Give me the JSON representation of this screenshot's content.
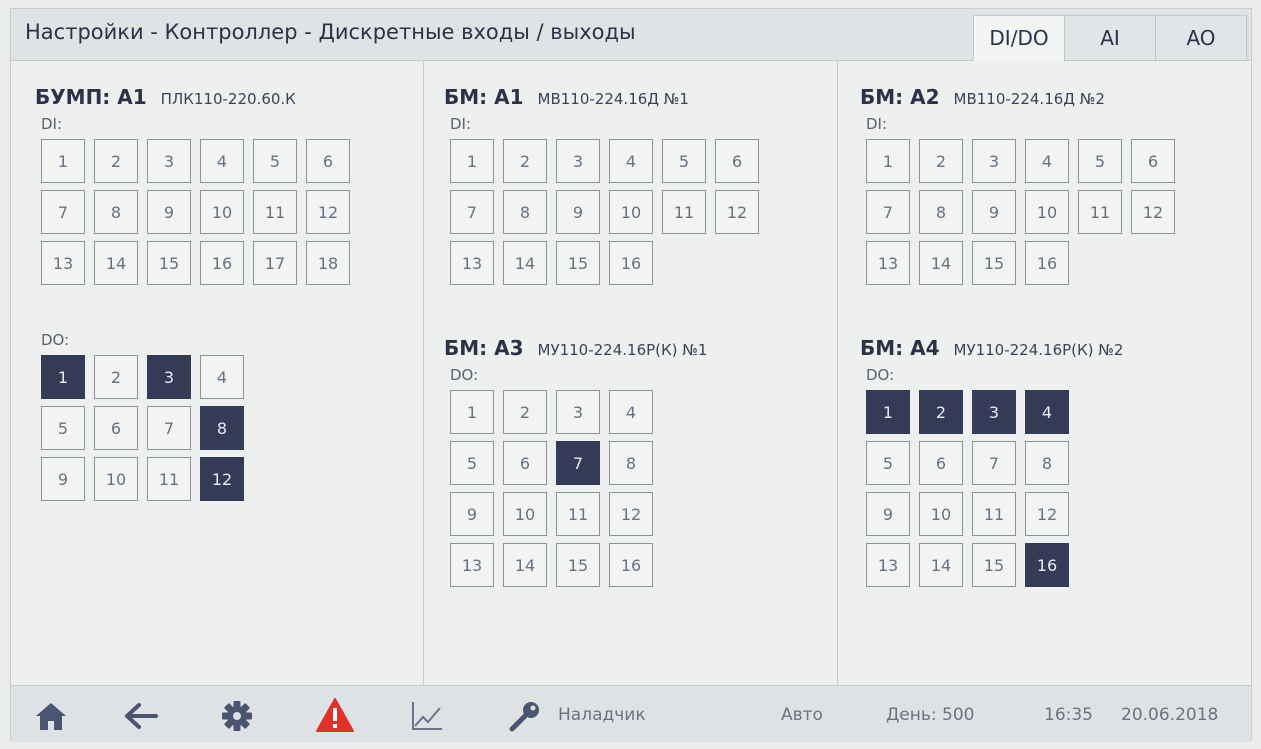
{
  "header": {
    "title": "Настройки - Контроллер - Дискретные входы / выходы",
    "tabs": [
      {
        "label": "DI/DO",
        "active": true
      },
      {
        "label": "AI",
        "active": false
      },
      {
        "label": "AO",
        "active": false
      }
    ]
  },
  "blocks": [
    {
      "id": "bump-a1",
      "name": "БУМП: A1",
      "model": "ПЛК110-220.60.К",
      "section": "DI:",
      "columns": 6,
      "cells": [
        {
          "n": "1",
          "on": false
        },
        {
          "n": "2",
          "on": false
        },
        {
          "n": "3",
          "on": false
        },
        {
          "n": "4",
          "on": false
        },
        {
          "n": "5",
          "on": false
        },
        {
          "n": "6",
          "on": false
        },
        {
          "n": "7",
          "on": false
        },
        {
          "n": "8",
          "on": false
        },
        {
          "n": "9",
          "on": false
        },
        {
          "n": "10",
          "on": false
        },
        {
          "n": "11",
          "on": false
        },
        {
          "n": "12",
          "on": false
        },
        {
          "n": "13",
          "on": false
        },
        {
          "n": "14",
          "on": false
        },
        {
          "n": "15",
          "on": false
        },
        {
          "n": "16",
          "on": false
        },
        {
          "n": "17",
          "on": false
        },
        {
          "n": "18",
          "on": false
        }
      ]
    },
    {
      "id": "bump-a1-do",
      "name": "",
      "model": "",
      "section": "DO:",
      "columns": 4,
      "cells": [
        {
          "n": "1",
          "on": true
        },
        {
          "n": "2",
          "on": false
        },
        {
          "n": "3",
          "on": true
        },
        {
          "n": "4",
          "on": false
        },
        {
          "n": "5",
          "on": false
        },
        {
          "n": "6",
          "on": false
        },
        {
          "n": "7",
          "on": false
        },
        {
          "n": "8",
          "on": true
        },
        {
          "n": "9",
          "on": false
        },
        {
          "n": "10",
          "on": false
        },
        {
          "n": "11",
          "on": false
        },
        {
          "n": "12",
          "on": true
        }
      ]
    },
    {
      "id": "bm-a1",
      "name": "БМ: A1",
      "model": "МВ110-224.16Д №1",
      "section": "DI:",
      "columns": 6,
      "cells": [
        {
          "n": "1",
          "on": false
        },
        {
          "n": "2",
          "on": false
        },
        {
          "n": "3",
          "on": false
        },
        {
          "n": "4",
          "on": false
        },
        {
          "n": "5",
          "on": false
        },
        {
          "n": "6",
          "on": false
        },
        {
          "n": "7",
          "on": false
        },
        {
          "n": "8",
          "on": false
        },
        {
          "n": "9",
          "on": false
        },
        {
          "n": "10",
          "on": false
        },
        {
          "n": "11",
          "on": false
        },
        {
          "n": "12",
          "on": false
        },
        {
          "n": "13",
          "on": false
        },
        {
          "n": "14",
          "on": false
        },
        {
          "n": "15",
          "on": false
        },
        {
          "n": "16",
          "on": false
        }
      ]
    },
    {
      "id": "bm-a3",
      "name": "БМ: A3",
      "model": "МУ110-224.16Р(К) №1",
      "section": "DO:",
      "columns": 4,
      "cells": [
        {
          "n": "1",
          "on": false
        },
        {
          "n": "2",
          "on": false
        },
        {
          "n": "3",
          "on": false
        },
        {
          "n": "4",
          "on": false
        },
        {
          "n": "5",
          "on": false
        },
        {
          "n": "6",
          "on": false
        },
        {
          "n": "7",
          "on": true
        },
        {
          "n": "8",
          "on": false
        },
        {
          "n": "9",
          "on": false
        },
        {
          "n": "10",
          "on": false
        },
        {
          "n": "11",
          "on": false
        },
        {
          "n": "12",
          "on": false
        },
        {
          "n": "13",
          "on": false
        },
        {
          "n": "14",
          "on": false
        },
        {
          "n": "15",
          "on": false
        },
        {
          "n": "16",
          "on": false
        }
      ]
    },
    {
      "id": "bm-a2",
      "name": "БМ: A2",
      "model": "МВ110-224.16Д №2",
      "section": "DI:",
      "columns": 6,
      "cells": [
        {
          "n": "1",
          "on": false
        },
        {
          "n": "2",
          "on": false
        },
        {
          "n": "3",
          "on": false
        },
        {
          "n": "4",
          "on": false
        },
        {
          "n": "5",
          "on": false
        },
        {
          "n": "6",
          "on": false
        },
        {
          "n": "7",
          "on": false
        },
        {
          "n": "8",
          "on": false
        },
        {
          "n": "9",
          "on": false
        },
        {
          "n": "10",
          "on": false
        },
        {
          "n": "11",
          "on": false
        },
        {
          "n": "12",
          "on": false
        },
        {
          "n": "13",
          "on": false
        },
        {
          "n": "14",
          "on": false
        },
        {
          "n": "15",
          "on": false
        },
        {
          "n": "16",
          "on": false
        }
      ]
    },
    {
      "id": "bm-a4",
      "name": "БМ: A4",
      "model": "МУ110-224.16Р(К) №2",
      "section": "DO:",
      "columns": 4,
      "cells": [
        {
          "n": "1",
          "on": true
        },
        {
          "n": "2",
          "on": true
        },
        {
          "n": "3",
          "on": true
        },
        {
          "n": "4",
          "on": true
        },
        {
          "n": "5",
          "on": false
        },
        {
          "n": "6",
          "on": false
        },
        {
          "n": "7",
          "on": false
        },
        {
          "n": "8",
          "on": false
        },
        {
          "n": "9",
          "on": false
        },
        {
          "n": "10",
          "on": false
        },
        {
          "n": "11",
          "on": false
        },
        {
          "n": "12",
          "on": false
        },
        {
          "n": "13",
          "on": false
        },
        {
          "n": "14",
          "on": false
        },
        {
          "n": "15",
          "on": false
        },
        {
          "n": "16",
          "on": true
        }
      ]
    }
  ],
  "footer": {
    "icons": [
      "home-icon",
      "back-arrow-icon",
      "gear-icon",
      "alarm-warning-icon",
      "trend-chart-icon",
      "key-icon"
    ],
    "user": "Наладчик",
    "mode": "Авто",
    "day": "День: 500",
    "time": "16:35",
    "date": "20.06.2018"
  },
  "colors": {
    "active_cell": "#343b57",
    "alarm": "#e0322a",
    "icon": "#4b5571"
  }
}
